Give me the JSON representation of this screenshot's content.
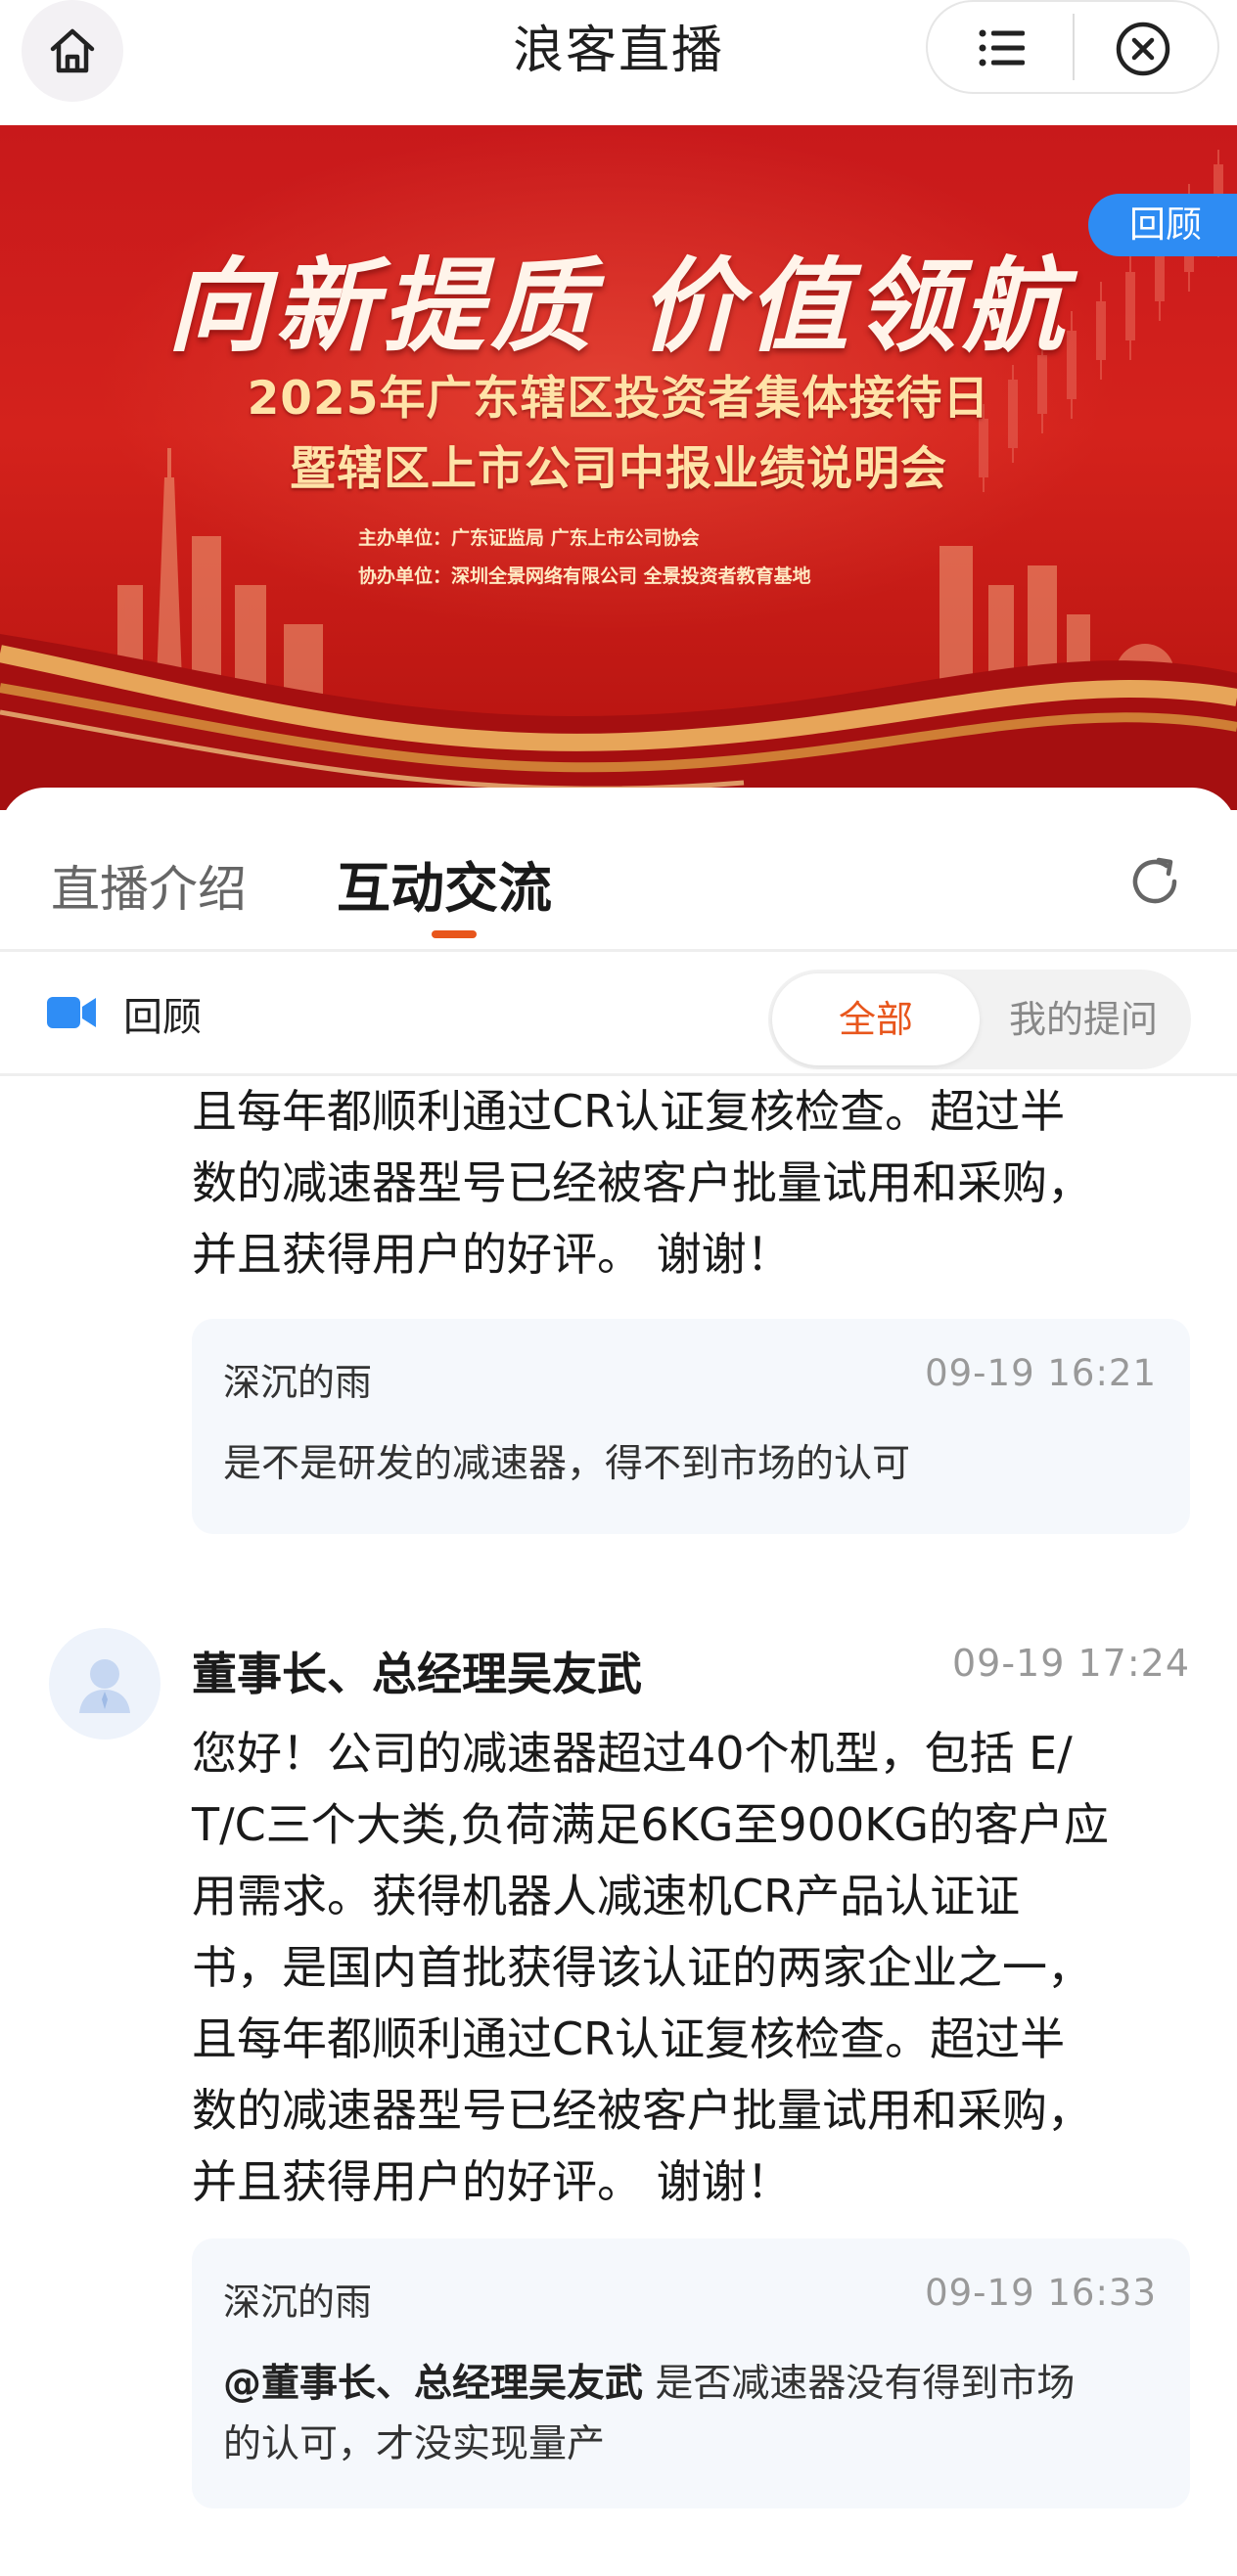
{
  "nav": {
    "title": "浪客直播",
    "home_icon": "home-icon",
    "menu_icon": "list-icon",
    "close_icon": "close-circle-icon"
  },
  "banner": {
    "slogan": "向新提质 价值领航",
    "title_line1": "2025年广东辖区投资者集体接待日",
    "title_line2": "暨辖区上市公司中报业绩说明会",
    "host": "主办单位：广东证监局  广东上市公司协会",
    "co_organizer": "协办单位：深圳全景网络有限公司  全景投资者教育基地",
    "badge": "回顾",
    "colors": {
      "background": "#c8191b",
      "gold": "#ffe3a8"
    }
  },
  "tabs": {
    "intro": "直播介绍",
    "interact": "互动交流",
    "active": "互动交流",
    "refresh_icon": "refresh-icon",
    "accent": "#e8561c"
  },
  "subbar": {
    "replay_label": "回顾",
    "video_icon": "video-camera-icon",
    "filter_all": "全部",
    "filter_mine": "我的提问",
    "selected": "全部"
  },
  "feed": [
    {
      "answer_lines": [
        "且每年都顺利通过CR认证复核检查。超过半",
        "数的减速器型号已经被客户批量试用和采购，",
        "并且获得用户的好评。 谢谢！"
      ],
      "question": {
        "user": "深沉的雨",
        "time": "09-19 16:21",
        "mention": "",
        "text": "是不是研发的减速器，得不到市场的认可"
      }
    },
    {
      "author": "董事长、总经理吴友武",
      "time": "09-19 17:24",
      "avatar_icon": "user-avatar-icon",
      "answer_lines": [
        "您好！公司的减速器超过40个机型，包括 E/",
        "T/C三个大类,负荷满足6KG至900KG的客户应",
        "用需求。获得机器人减速机CR产品认证证",
        "书，是国内首批获得该认证的两家企业之一，",
        "且每年都顺利通过CR认证复核检查。超过半",
        "数的减速器型号已经被客户批量试用和采购，",
        "并且获得用户的好评。 谢谢！"
      ],
      "question": {
        "user": "深沉的雨",
        "time": "09-19 16:33",
        "mention": "@董事长、总经理吴友武",
        "text_line1": " 是否减速器没有得到市场",
        "text_line2": "的认可，才没实现量产"
      }
    }
  ]
}
